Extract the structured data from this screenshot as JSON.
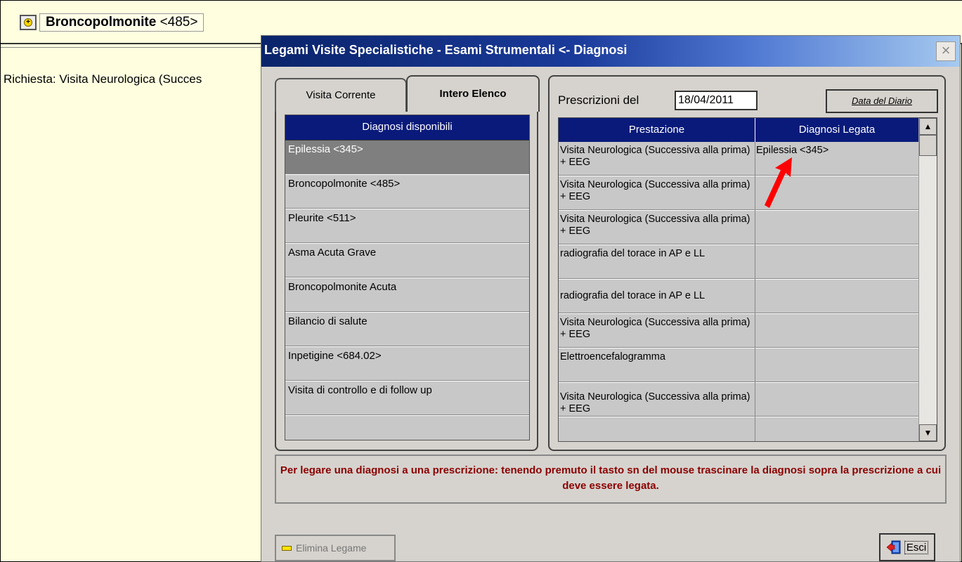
{
  "background": {
    "header_title": "Broncopolmonite",
    "header_code": "<485>",
    "richiesta_text": "Richiesta: Visita Neurologica (Succes"
  },
  "dialog": {
    "title": "Legami Visite Specialistiche - Esami Strumentali <- Diagnosi",
    "close_label": "×",
    "tabs": [
      {
        "label": "Visita Corrente"
      },
      {
        "label": "Intero Elenco"
      }
    ],
    "diagnosi": {
      "header": "Diagnosi disponibili",
      "items": [
        {
          "label": "Epilessia <345>"
        },
        {
          "label": "Broncopolmonite <485>"
        },
        {
          "label": "Pleurite <511>"
        },
        {
          "label": "Asma Acuta Grave"
        },
        {
          "label": "Broncopolmonite Acuta"
        },
        {
          "label": "Bilancio di salute"
        },
        {
          "label": "Inpetigine <684.02>"
        },
        {
          "label": "Visita di controllo e di follow up"
        },
        {
          "label": ""
        }
      ]
    },
    "prescrizioni": {
      "label": "Prescrizioni del",
      "date": "18/04/2011",
      "data_diario_label": "Data del Diario",
      "columns": [
        "Prestazione",
        "Diagnosi Legata"
      ],
      "rows": [
        {
          "prestazione": "Visita Neurologica (Successiva alla prima) + EEG",
          "diagnosi": "Epilessia <345>"
        },
        {
          "prestazione": "Visita Neurologica (Successiva alla prima) + EEG",
          "diagnosi": ""
        },
        {
          "prestazione": "Visita Neurologica (Successiva alla prima) + EEG",
          "diagnosi": ""
        },
        {
          "prestazione": "radiografia del torace in AP e LL",
          "diagnosi": ""
        },
        {
          "prestazione": "radiografia del torace in AP e LL",
          "diagnosi": ""
        },
        {
          "prestazione": "Visita Neurologica (Successiva alla prima) + EEG",
          "diagnosi": ""
        },
        {
          "prestazione": "Elettroencefalogramma",
          "diagnosi": ""
        },
        {
          "prestazione": "Visita Neurologica (Successiva alla prima) + EEG",
          "diagnosi": ""
        },
        {
          "prestazione": "",
          "diagnosi": ""
        }
      ]
    },
    "instruction": "Per legare una diagnosi a una prescrizione: tenendo premuto il tasto sn del mouse trascinare la diagnosi sopra la prescrizione a cui deve essere legata.",
    "elimina_label": "Elimina Legame",
    "esci_label": "Esci"
  },
  "colors": {
    "header_bar": "#0a1a7a",
    "selected_item": "#7f7f7f",
    "instruction_text": "#8b0000",
    "annotation_arrow": "#ff0000"
  }
}
